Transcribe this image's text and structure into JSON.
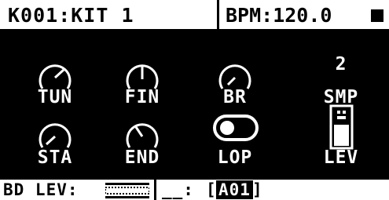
{
  "header": {
    "kit": "K001:KIT 1",
    "bpm": "BPM:120.0",
    "transport_icon": "stop-icon"
  },
  "params": {
    "row1": [
      {
        "label": "TUN",
        "control": "knob",
        "value_fraction": 0.62
      },
      {
        "label": "FIN",
        "control": "knob",
        "value_fraction": 0.5
      },
      {
        "label": "BR",
        "control": "knob",
        "value_fraction": 0.15
      },
      {
        "label": "SMP",
        "control": "value",
        "value": "2"
      }
    ],
    "row2": [
      {
        "label": "STA",
        "control": "knob",
        "value_fraction": 0.1
      },
      {
        "label": "END",
        "control": "knob",
        "value_fraction": 0.38
      },
      {
        "label": "LOP",
        "control": "toggle",
        "state": "off"
      },
      {
        "label": "LEV",
        "control": "fader",
        "value_fraction": 0.9
      }
    ]
  },
  "footer": {
    "track": "BD LEV:",
    "lock": "__:",
    "sample_slot": "A01",
    "bracket_open": "[",
    "bracket_close": "]"
  }
}
